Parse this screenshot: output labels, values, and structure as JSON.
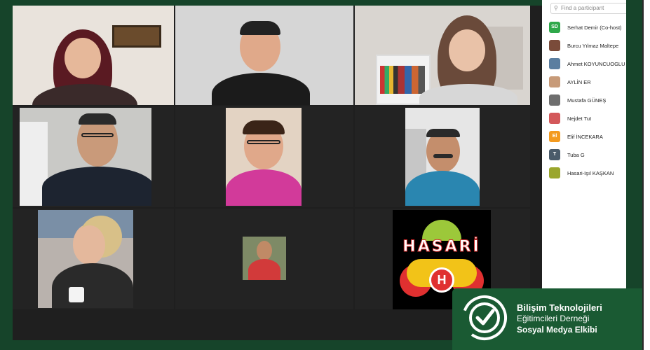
{
  "panel": {
    "search_placeholder": "Find a participant",
    "participants": [
      {
        "initials": "SD",
        "name": "Serhat Demir (Co-host)",
        "color": "#2ea84a"
      },
      {
        "initials": "",
        "name": "Burcu Yılmaz Maltepe",
        "color": "#7a4b3a"
      },
      {
        "initials": "",
        "name": "Ahmet KOYUNCUOGLU",
        "color": "#5b7ea0"
      },
      {
        "initials": "",
        "name": "AYLİN ER",
        "color": "#c79a78"
      },
      {
        "initials": "",
        "name": "Mustafa GÜNEŞ",
        "color": "#6e6e6e"
      },
      {
        "initials": "",
        "name": "Nejdet Tut",
        "color": "#d3585a"
      },
      {
        "initials": "El",
        "name": "Elif İNCEKARA",
        "color": "#f39a1f"
      },
      {
        "initials": "T",
        "name": "Tuba G",
        "color": "#4a5b6a"
      },
      {
        "initials": "",
        "name": "Hasari-Işıl KAŞKAN",
        "color": "#9aa62c"
      }
    ]
  },
  "tiles": {
    "hasari_logo_text": "HASARİ",
    "hasari_letter": "H"
  },
  "brand": {
    "line1": "Bilişim Teknolojileri",
    "line2": "Eğitimcileri Derneği",
    "line3": "Sosyal Medya Elkibi"
  }
}
